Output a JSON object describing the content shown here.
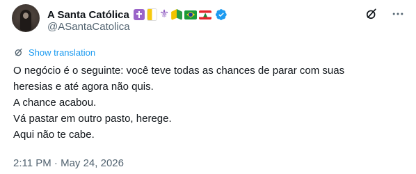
{
  "author": {
    "display_name": "A Santa Católica",
    "handle": "@ASantaCatolica",
    "badges": [
      "latin-cross-box",
      "vatican-flag",
      "fleur-de-lis",
      "japanese-beginner-symbol",
      "brazil-flag",
      "lebanon-flag"
    ],
    "verified": true,
    "verified_color": "#1d9bf0"
  },
  "actions": {
    "grok_icon": "slashed-circle-icon",
    "more_icon": "more-horizontal-icon"
  },
  "translation": {
    "label": "Show translation",
    "color": "#1d9bf0"
  },
  "tweet": {
    "lines": [
      "O negócio é o seguinte: você teve todas as chances de parar com suas",
      "heresias e até agora não quis.",
      "A chance acabou.",
      "Vá pastar em outro pasto, herege.",
      "Aqui não te cabe."
    ]
  },
  "meta": {
    "timestamp": "2:11 PM · May 24, 2026"
  }
}
